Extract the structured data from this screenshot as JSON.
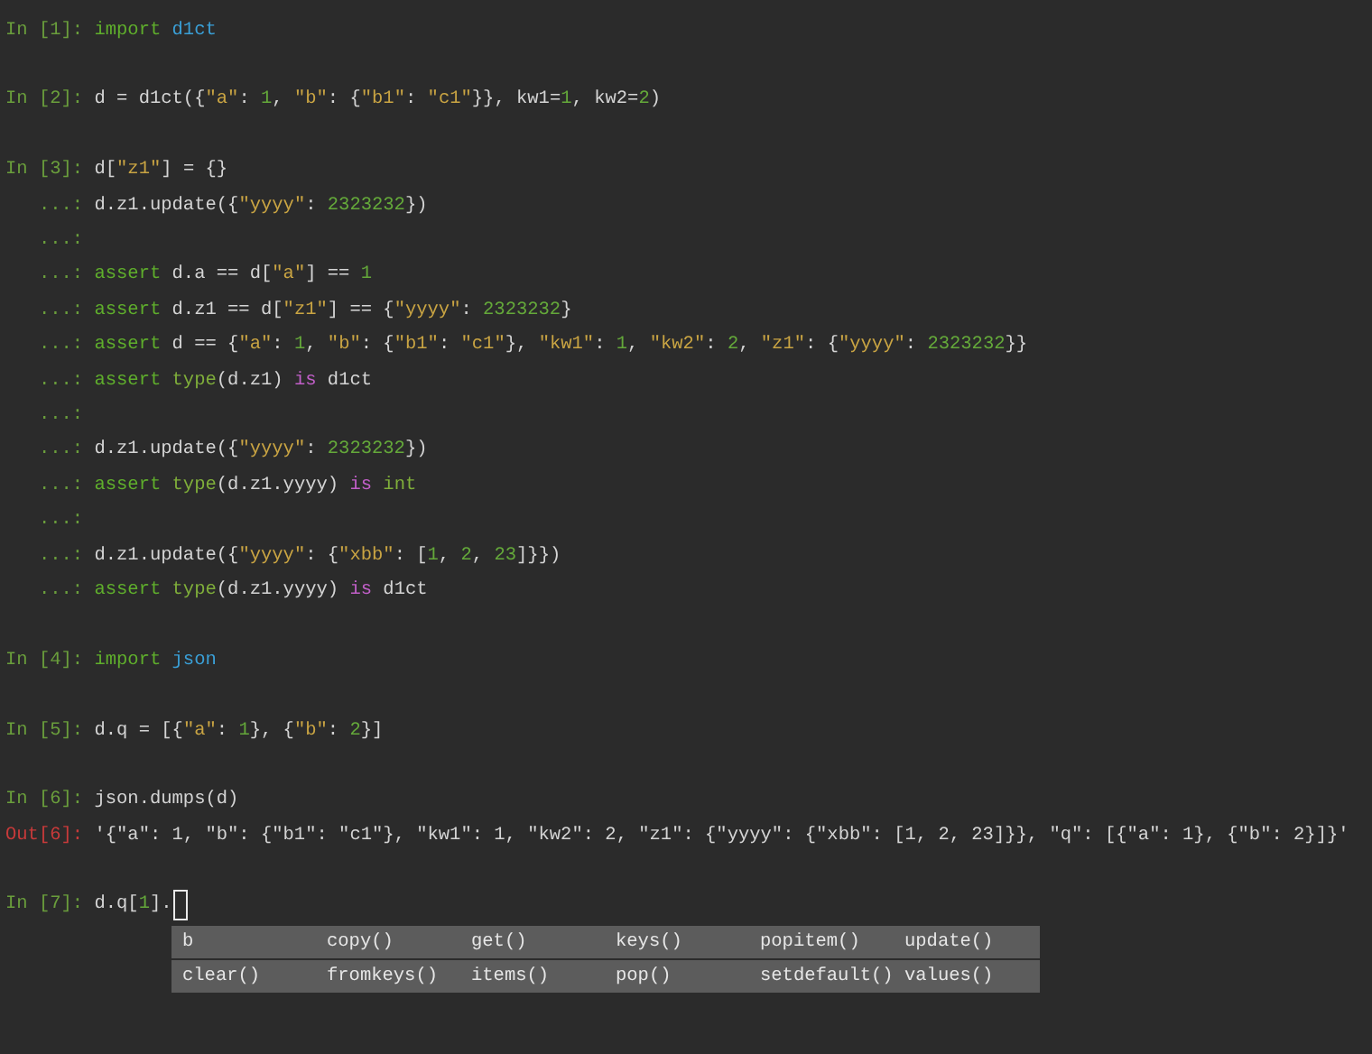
{
  "cells": [
    {
      "lines": [
        {
          "prompt": "In [1]: ",
          "kind": "in",
          "tokens": [
            {
              "kind": "kw",
              "text": "import"
            },
            {
              "kind": "mod",
              "text": " d1ct"
            }
          ]
        }
      ]
    },
    {
      "lines": [
        {
          "prompt": "In [2]: ",
          "kind": "in",
          "tokens": [
            {
              "kind": "p",
              "text": "d = d1ct({"
            },
            {
              "kind": "str",
              "text": "\"a\""
            },
            {
              "kind": "p",
              "text": ": "
            },
            {
              "kind": "num",
              "text": "1"
            },
            {
              "kind": "p",
              "text": ", "
            },
            {
              "kind": "str",
              "text": "\"b\""
            },
            {
              "kind": "p",
              "text": ": {"
            },
            {
              "kind": "str",
              "text": "\"b1\""
            },
            {
              "kind": "p",
              "text": ": "
            },
            {
              "kind": "str",
              "text": "\"c1\""
            },
            {
              "kind": "p",
              "text": "}}, kw1="
            },
            {
              "kind": "num",
              "text": "1"
            },
            {
              "kind": "p",
              "text": ", kw2="
            },
            {
              "kind": "num",
              "text": "2"
            },
            {
              "kind": "p",
              "text": ")"
            }
          ]
        }
      ]
    },
    {
      "lines": [
        {
          "prompt": "In [3]: ",
          "kind": "in",
          "tokens": [
            {
              "kind": "p",
              "text": "d["
            },
            {
              "kind": "str",
              "text": "\"z1\""
            },
            {
              "kind": "p",
              "text": "] = {}"
            }
          ]
        },
        {
          "prompt": "   ...: ",
          "kind": "cont",
          "tokens": [
            {
              "kind": "p",
              "text": "d.z1.update({"
            },
            {
              "kind": "str",
              "text": "\"yyyy\""
            },
            {
              "kind": "p",
              "text": ": "
            },
            {
              "kind": "num",
              "text": "2323232"
            },
            {
              "kind": "p",
              "text": "})"
            }
          ]
        },
        {
          "prompt": "   ...: ",
          "kind": "cont"
        },
        {
          "prompt": "   ...: ",
          "kind": "cont",
          "tokens": [
            {
              "kind": "kw",
              "text": "assert"
            },
            {
              "kind": "p",
              "text": " d.a == d["
            },
            {
              "kind": "str",
              "text": "\"a\""
            },
            {
              "kind": "p",
              "text": "] == "
            },
            {
              "kind": "num",
              "text": "1"
            }
          ]
        },
        {
          "prompt": "   ...: ",
          "kind": "cont",
          "tokens": [
            {
              "kind": "kw",
              "text": "assert"
            },
            {
              "kind": "p",
              "text": " d.z1 == d["
            },
            {
              "kind": "str",
              "text": "\"z1\""
            },
            {
              "kind": "p",
              "text": "] == {"
            },
            {
              "kind": "str",
              "text": "\"yyyy\""
            },
            {
              "kind": "p",
              "text": ": "
            },
            {
              "kind": "num",
              "text": "2323232"
            },
            {
              "kind": "p",
              "text": "}"
            }
          ]
        },
        {
          "prompt": "   ...: ",
          "kind": "cont",
          "tokens": [
            {
              "kind": "kw",
              "text": "assert"
            },
            {
              "kind": "p",
              "text": " d == {"
            },
            {
              "kind": "str",
              "text": "\"a\""
            },
            {
              "kind": "p",
              "text": ": "
            },
            {
              "kind": "num",
              "text": "1"
            },
            {
              "kind": "p",
              "text": ", "
            },
            {
              "kind": "str",
              "text": "\"b\""
            },
            {
              "kind": "p",
              "text": ": {"
            },
            {
              "kind": "str",
              "text": "\"b1\""
            },
            {
              "kind": "p",
              "text": ": "
            },
            {
              "kind": "str",
              "text": "\"c1\""
            },
            {
              "kind": "p",
              "text": "}, "
            },
            {
              "kind": "str",
              "text": "\"kw1\""
            },
            {
              "kind": "p",
              "text": ": "
            },
            {
              "kind": "num",
              "text": "1"
            },
            {
              "kind": "p",
              "text": ", "
            },
            {
              "kind": "str",
              "text": "\"kw2\""
            },
            {
              "kind": "p",
              "text": ": "
            },
            {
              "kind": "num",
              "text": "2"
            },
            {
              "kind": "p",
              "text": ", "
            },
            {
              "kind": "str",
              "text": "\"z1\""
            },
            {
              "kind": "p",
              "text": ": {"
            },
            {
              "kind": "str",
              "text": "\"yyyy\""
            },
            {
              "kind": "p",
              "text": ": "
            },
            {
              "kind": "num",
              "text": "2323232"
            },
            {
              "kind": "p",
              "text": "}}"
            }
          ]
        },
        {
          "prompt": "   ...: ",
          "kind": "cont",
          "tokens": [
            {
              "kind": "kw",
              "text": "assert"
            },
            {
              "kind": "bi",
              "text": " type"
            },
            {
              "kind": "p",
              "text": "(d.z1) "
            },
            {
              "kind": "op",
              "text": "is"
            },
            {
              "kind": "p",
              "text": " d1ct"
            }
          ]
        },
        {
          "prompt": "   ...: ",
          "kind": "cont"
        },
        {
          "prompt": "   ...: ",
          "kind": "cont",
          "tokens": [
            {
              "kind": "p",
              "text": "d.z1.update({"
            },
            {
              "kind": "str",
              "text": "\"yyyy\""
            },
            {
              "kind": "p",
              "text": ": "
            },
            {
              "kind": "num",
              "text": "2323232"
            },
            {
              "kind": "p",
              "text": "})"
            }
          ]
        },
        {
          "prompt": "   ...: ",
          "kind": "cont",
          "tokens": [
            {
              "kind": "kw",
              "text": "assert"
            },
            {
              "kind": "bi",
              "text": " type"
            },
            {
              "kind": "p",
              "text": "(d.z1.yyyy) "
            },
            {
              "kind": "op",
              "text": "is"
            },
            {
              "kind": "bi",
              "text": " int"
            }
          ]
        },
        {
          "prompt": "   ...: ",
          "kind": "cont"
        },
        {
          "prompt": "   ...: ",
          "kind": "cont",
          "tokens": [
            {
              "kind": "p",
              "text": "d.z1.update({"
            },
            {
              "kind": "str",
              "text": "\"yyyy\""
            },
            {
              "kind": "p",
              "text": ": {"
            },
            {
              "kind": "str",
              "text": "\"xbb\""
            },
            {
              "kind": "p",
              "text": ": ["
            },
            {
              "kind": "num",
              "text": "1"
            },
            {
              "kind": "p",
              "text": ", "
            },
            {
              "kind": "num",
              "text": "2"
            },
            {
              "kind": "p",
              "text": ", "
            },
            {
              "kind": "num",
              "text": "23"
            },
            {
              "kind": "p",
              "text": "]}})"
            }
          ]
        },
        {
          "prompt": "   ...: ",
          "kind": "cont",
          "tokens": [
            {
              "kind": "kw",
              "text": "assert"
            },
            {
              "kind": "bi",
              "text": " type"
            },
            {
              "kind": "p",
              "text": "(d.z1.yyyy) "
            },
            {
              "kind": "op",
              "text": "is"
            },
            {
              "kind": "p",
              "text": " d1ct"
            }
          ]
        }
      ]
    },
    {
      "lines": [
        {
          "prompt": "In [4]: ",
          "kind": "in",
          "tokens": [
            {
              "kind": "kw",
              "text": "import"
            },
            {
              "kind": "mod",
              "text": " json"
            }
          ]
        }
      ]
    },
    {
      "lines": [
        {
          "prompt": "In [5]: ",
          "kind": "in",
          "tokens": [
            {
              "kind": "p",
              "text": "d.q = [{"
            },
            {
              "kind": "str",
              "text": "\"a\""
            },
            {
              "kind": "p",
              "text": ": "
            },
            {
              "kind": "num",
              "text": "1"
            },
            {
              "kind": "p",
              "text": "}, {"
            },
            {
              "kind": "str",
              "text": "\"b\""
            },
            {
              "kind": "p",
              "text": ": "
            },
            {
              "kind": "num",
              "text": "2"
            },
            {
              "kind": "p",
              "text": "}]"
            }
          ]
        }
      ]
    },
    {
      "lines": [
        {
          "prompt": "In [6]: ",
          "kind": "in",
          "tokens": [
            {
              "kind": "p",
              "text": "json.dumps(d)"
            }
          ]
        },
        {
          "prompt": "Out[6]: ",
          "kind": "out",
          "tokens": [
            {
              "kind": "p",
              "text": "'{\"a\": 1, \"b\": {\"b1\": \"c1\"}, \"kw1\": 1, \"kw2\": 2, \"z1\": {\"yyyy\": {\"xbb\": [1, 2, 23]}}, \"q\": [{\"a\": 1}, {\"b\": 2}]}'"
            }
          ]
        }
      ]
    },
    {
      "lines": [
        {
          "prompt": "In [7]: ",
          "kind": "in",
          "cursor": true,
          "tokens": [
            {
              "kind": "p",
              "text": "d.q["
            },
            {
              "kind": "num",
              "text": "1"
            },
            {
              "kind": "p",
              "text": "]."
            }
          ]
        }
      ]
    }
  ],
  "completions": [
    [
      "b",
      "copy()",
      "get()",
      "keys()",
      "popitem()",
      "update()"
    ],
    [
      "clear()",
      "fromkeys()",
      "items()",
      "pop()",
      "setdefault()",
      "values()"
    ]
  ]
}
